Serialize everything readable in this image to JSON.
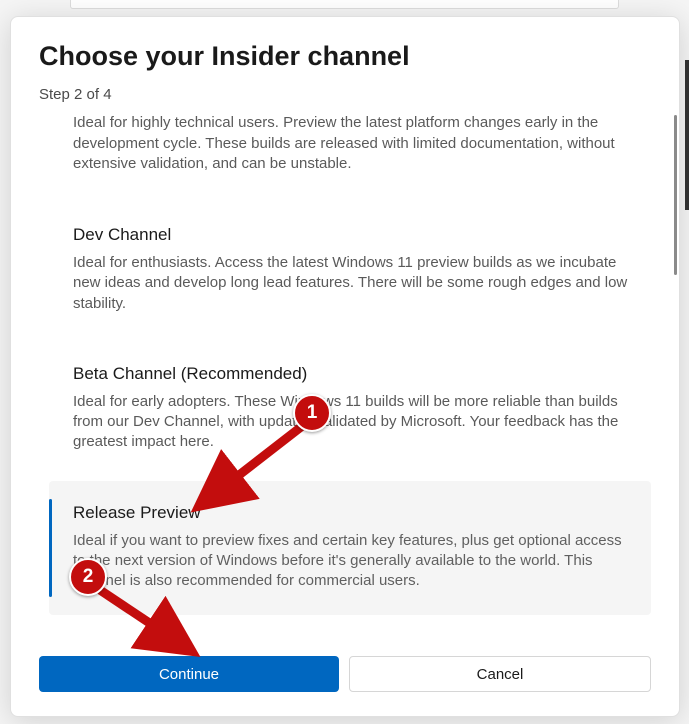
{
  "dialog": {
    "title": "Choose your Insider channel",
    "step": "Step 2 of 4"
  },
  "channels": {
    "canary": {
      "desc": "Ideal for highly technical users. Preview the latest platform changes early in the development cycle. These builds are released with limited documentation, without extensive validation, and can be unstable."
    },
    "dev": {
      "title": "Dev Channel",
      "desc": "Ideal for enthusiasts. Access the latest Windows 11 preview builds as we incubate new ideas and develop long lead features. There will be some rough edges and low stability."
    },
    "beta": {
      "title": "Beta Channel (Recommended)",
      "desc": "Ideal for early adopters. These Windows 11 builds will be more reliable than builds from our Dev Channel, with updates validated by Microsoft. Your feedback has the greatest impact here."
    },
    "release": {
      "title": "Release Preview",
      "desc": "Ideal if you want to preview fixes and certain key features, plus get optional access to the next version of Windows before it's generally available to the world. This channel is also recommended for commercial users."
    }
  },
  "buttons": {
    "continue": "Continue",
    "cancel": "Cancel"
  },
  "annotations": {
    "badge1": "1",
    "badge2": "2"
  }
}
